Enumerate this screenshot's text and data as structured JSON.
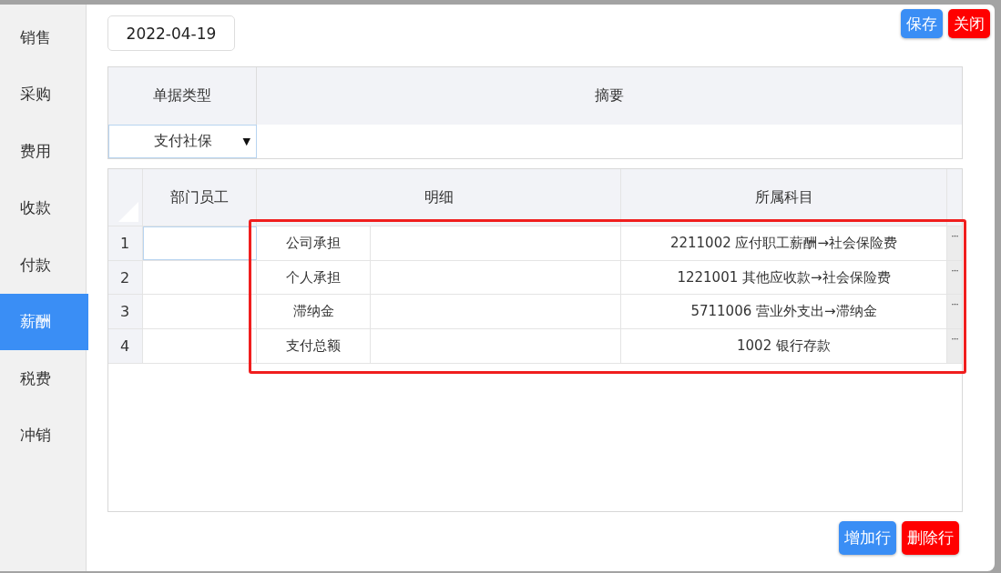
{
  "sidebar": {
    "items": [
      {
        "label": "销售",
        "selected": false
      },
      {
        "label": "采购",
        "selected": false
      },
      {
        "label": "费用",
        "selected": false
      },
      {
        "label": "收款",
        "selected": false
      },
      {
        "label": "付款",
        "selected": false
      },
      {
        "label": "薪酬",
        "selected": true
      },
      {
        "label": "税费",
        "selected": false
      },
      {
        "label": "冲销",
        "selected": false
      }
    ]
  },
  "date": {
    "value": "2022-04-19"
  },
  "top_buttons": [
    {
      "label": "保存",
      "kind": "primary"
    },
    {
      "label": "关闭",
      "kind": "danger"
    }
  ],
  "bill": {
    "columns": [
      "单据类型",
      "摘要"
    ],
    "doc_type": {
      "value": "支付社保",
      "caret": "▼"
    }
  },
  "grid": {
    "columns": [
      "部门员工",
      "明细",
      "所属科目"
    ],
    "rows": [
      {
        "index": "1",
        "focused": true,
        "detail": "公司承担",
        "account": "2211002 应付职工薪酬→社会保险费",
        "more": "···"
      },
      {
        "index": "2",
        "focused": false,
        "detail": "个人承担",
        "account": "1221001 其他应收款→社会保险费",
        "more": "···"
      },
      {
        "index": "3",
        "focused": false,
        "detail": "滞纳金",
        "account": "5711006 营业外支出→滞纳金",
        "more": "···"
      },
      {
        "index": "4",
        "focused": false,
        "detail": "支付总额",
        "account": "1002 银行存款",
        "more": "···"
      }
    ]
  },
  "bottom_buttons": [
    {
      "label": "增加行",
      "kind": "primary"
    },
    {
      "label": "删除行",
      "kind": "danger"
    }
  ]
}
